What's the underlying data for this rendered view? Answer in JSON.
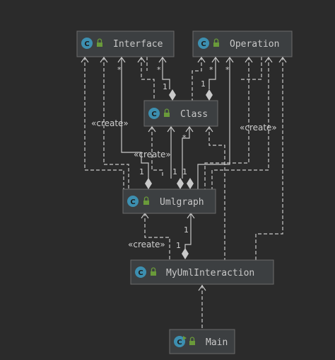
{
  "nodes": {
    "interface": {
      "label": "Interface",
      "kind": "class"
    },
    "operation": {
      "label": "Operation",
      "kind": "class"
    },
    "class": {
      "label": "Class",
      "kind": "class"
    },
    "umlgraph": {
      "label": "Umlgraph",
      "kind": "class"
    },
    "myumlinteraction": {
      "label": "MyUmlInteraction",
      "kind": "class"
    },
    "main": {
      "label": "Main",
      "kind": "class-runnable"
    }
  },
  "icons": {
    "class_badge": "C",
    "visibility": "lock-icon"
  },
  "stereotypes": {
    "create_left": "«create»",
    "create_middle": "«create»",
    "create_right": "«create»",
    "create_bottom": "«create»"
  },
  "multiplicities": {
    "iface_star": "*",
    "iface_class_star": "*",
    "iface_class_one": "1",
    "op_star_a": "*",
    "op_star_b": "*",
    "op_class_one": "1",
    "class_star": "*",
    "ug_one_a": "1",
    "ug_one_b": "1",
    "ug_one_c": "1",
    "mui_one_a": "1",
    "mui_one_b": "1"
  },
  "colors": {
    "background": "#2b2b2b",
    "node_fill": "#3c3f41",
    "node_border": "#6b6b6b",
    "badge": "#3d8fb0",
    "lock": "#6a9a3a",
    "edge": "#c9c9c9"
  }
}
